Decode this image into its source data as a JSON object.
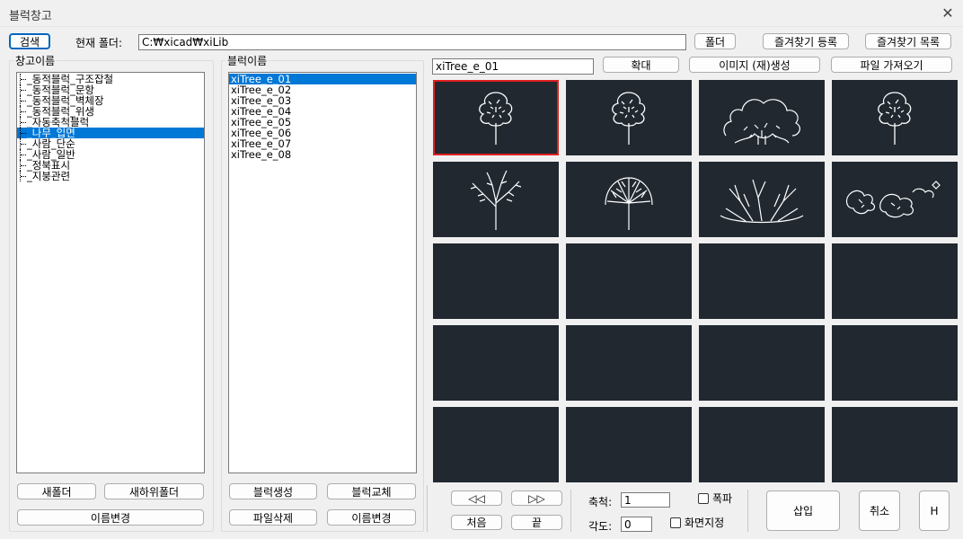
{
  "window": {
    "title": "블럭창고",
    "close_glyph": "✕"
  },
  "toolbar": {
    "search_label": "검색",
    "current_folder_label": "현재 폴더:",
    "current_folder_value": "C:₩xicad₩xiLib",
    "folder_button": "폴더",
    "add_favorite": "즐겨찾기 등록",
    "favorite_list": "즐겨찾기 목록"
  },
  "repo_panel": {
    "legend": "창고이름",
    "items": [
      {
        "label": "_동적블럭_구조잡철",
        "selected": false
      },
      {
        "label": "_동적블럭_문항",
        "selected": false
      },
      {
        "label": "_동적블럭_벽체장",
        "selected": false
      },
      {
        "label": "_동적블럭_위생",
        "selected": false
      },
      {
        "label": "_자동축척블럭",
        "selected": false
      },
      {
        "label": "_나무_입면",
        "selected": true
      },
      {
        "label": "_사람_단순",
        "selected": false
      },
      {
        "label": "_사람_일반",
        "selected": false
      },
      {
        "label": "_정북표시",
        "selected": false
      },
      {
        "label": "_지붕관련",
        "selected": false
      }
    ],
    "new_folder": "새폴더",
    "new_subfolder": "새하위폴더",
    "rename": "이름변경"
  },
  "block_panel": {
    "legend": "블럭이름",
    "items": [
      {
        "label": "xiTree_e_01",
        "selected": true
      },
      {
        "label": "xiTree_e_02",
        "selected": false
      },
      {
        "label": "xiTree_e_03",
        "selected": false
      },
      {
        "label": "xiTree_e_04",
        "selected": false
      },
      {
        "label": "xiTree_e_05",
        "selected": false
      },
      {
        "label": "xiTree_e_06",
        "selected": false
      },
      {
        "label": "xiTree_e_07",
        "selected": false
      },
      {
        "label": "xiTree_e_08",
        "selected": false
      }
    ],
    "create_block": "블럭생성",
    "replace_block": "블럭교체",
    "delete_file": "파일삭제",
    "rename": "이름변경"
  },
  "preview": {
    "name_value": "xiTree_e_01",
    "zoom": "확대",
    "regen_image": "이미지 (재)생성",
    "import_file": "파일 가져오기",
    "thumbnails": [
      "tree-round-icon",
      "tree-round-icon",
      "tree-wide-icon",
      "tree-round-icon",
      "tree-bare-icon",
      "tree-fan-icon",
      "shrub-branch-icon",
      "ground-cover-icon"
    ],
    "empty_cells": 12,
    "cell_bg": "#212830",
    "selected_outline": "#e02020"
  },
  "bottom": {
    "prev_page": "◁◁",
    "next_page": "▷▷",
    "first": "처음",
    "last": "끝",
    "scale_label": "축척:",
    "scale_value": "1",
    "angle_label": "각도:",
    "angle_value": "0",
    "explode": "폭파",
    "screen_pick": "화면지정",
    "insert": "삽입",
    "cancel": "취소",
    "help": "H"
  },
  "colors": {
    "selection": "#0078d7",
    "accent_border": "#0067c0"
  }
}
